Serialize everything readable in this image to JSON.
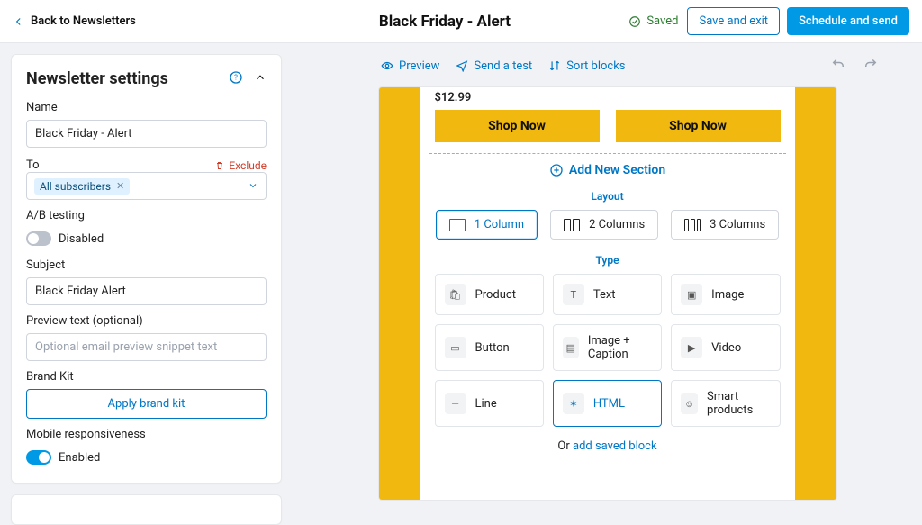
{
  "header": {
    "back": "Back to Newsletters",
    "title": "Black Friday - Alert",
    "saved": "Saved",
    "save_exit": "Save and exit",
    "schedule": "Schedule and send"
  },
  "settings": {
    "title": "Newsletter settings",
    "name_label": "Name",
    "name_value": "Black Friday - Alert",
    "to_label": "To",
    "exclude": "Exclude",
    "recipient": "All subscribers",
    "ab_label": "A/B testing",
    "ab_state": "Disabled",
    "subject_label": "Subject",
    "subject_value": "Black Friday Alert",
    "preview_label": "Preview text (optional)",
    "preview_placeholder": "Optional email preview snippet text",
    "brandkit_label": "Brand Kit",
    "apply_brandkit": "Apply brand kit",
    "mobile_label": "Mobile responsiveness",
    "mobile_state": "Enabled"
  },
  "toolbar": {
    "preview": "Preview",
    "send_test": "Send a test",
    "sort_blocks": "Sort blocks"
  },
  "email": {
    "price": "$12.99",
    "shop_now": "Shop Now",
    "add_section": "Add New Section",
    "layout_title": "Layout",
    "layouts": [
      "1 Column",
      "2 Columns",
      "3 Columns"
    ],
    "type_title": "Type",
    "types": [
      "Product",
      "Text",
      "Image",
      "Button",
      "Image + Caption",
      "Video",
      "Line",
      "HTML",
      "Smart products"
    ],
    "or": "Or ",
    "add_saved_block": "add saved block"
  }
}
